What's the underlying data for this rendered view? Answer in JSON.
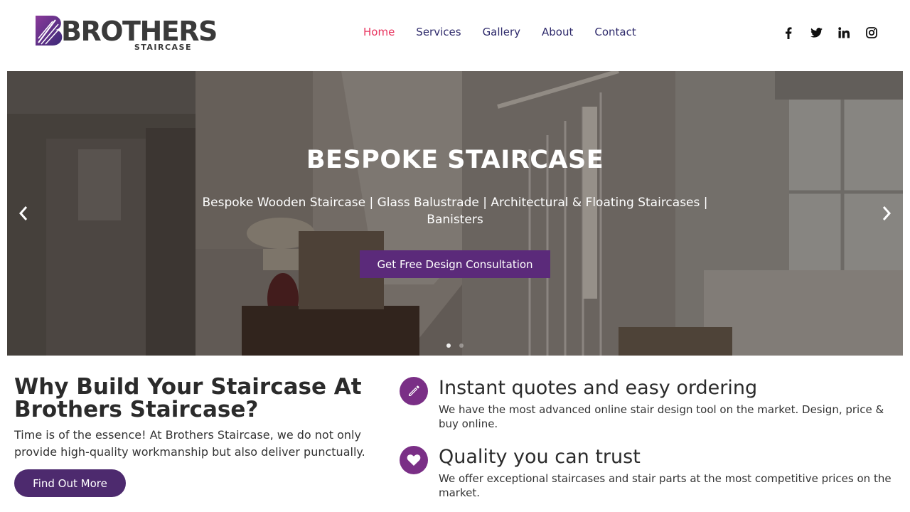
{
  "brand": {
    "logo_text": "BROTHERS",
    "logo_subtext": "STAIRCASE"
  },
  "nav": {
    "items": [
      {
        "label": "Home",
        "active": true
      },
      {
        "label": "Services",
        "active": false
      },
      {
        "label": "Gallery",
        "active": false
      },
      {
        "label": "About",
        "active": false
      },
      {
        "label": "Contact",
        "active": false
      }
    ]
  },
  "social": [
    "facebook-icon",
    "twitter-icon",
    "linkedin-icon",
    "instagram-icon"
  ],
  "hero": {
    "title": "BESPOKE STAIRCASE",
    "subtitle": "Bespoke Wooden Staircase | Glass Balustrade | Architectural & Floating Staircases | Banisters",
    "cta": "Get Free Design Consultation",
    "slide_count": 2,
    "active_slide": 1
  },
  "why": {
    "title": "Why Build Your Staircase At Brothers Staircase?",
    "text": "Time is of the essence! At Brothers Staircase, we do not only provide high-quality workmanship but also deliver punctually.",
    "button": "Find Out More"
  },
  "features": [
    {
      "icon": "pencil-icon",
      "title": "Instant quotes and easy ordering",
      "text": "We have the most advanced online stair design tool on the market. Design, price & buy online."
    },
    {
      "icon": "heart-icon",
      "title": "Quality you can trust",
      "text": "We offer exceptional staircases and stair parts at the most competitive prices on the market."
    }
  ],
  "colors": {
    "accent": "#5b2a7a",
    "nav_active": "#e8335e",
    "nav_link": "#2e2a6b",
    "icon_circle": "#7a2f86"
  }
}
